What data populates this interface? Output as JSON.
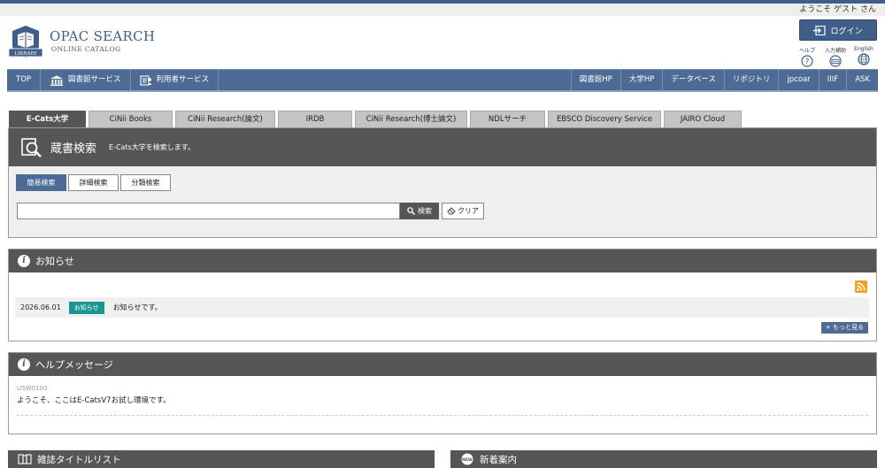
{
  "header": {
    "welcome": "ようこそ ゲスト さん",
    "logo_title": "OPAC SEARCH",
    "logo_subtitle": "ONLINE CATALOG",
    "logo_ribbon": "LIBRARY",
    "login_label": "ログイン",
    "utilities": [
      {
        "label": "ヘルプ",
        "icon": "help-icon"
      },
      {
        "label": "入力補助",
        "icon": "keyboard-icon"
      },
      {
        "label": "English",
        "icon": "globe-icon"
      }
    ]
  },
  "nav": {
    "left": [
      {
        "label": "TOP"
      },
      {
        "label": "図書館サービス",
        "icon": "library-icon"
      },
      {
        "label": "利用者サービス",
        "icon": "user-service-icon"
      }
    ],
    "right": [
      "図書館HP",
      "大学HP",
      "データベース",
      "リポジトリ",
      "jpcoar",
      "IIIF",
      "ASK"
    ]
  },
  "tabs": [
    "E-Cats大学",
    "CiNii Books",
    "CiNii Research(論文)",
    "IRDB",
    "CiNii Research(博士論文)",
    "NDLサーチ",
    "EBSCO Discovery Service",
    "JAIRO Cloud"
  ],
  "search": {
    "title": "蔵書検索",
    "description": "E-Cats大学を検索します。",
    "modes": [
      "簡易検索",
      "詳細検索",
      "分類検索"
    ],
    "input_value": "",
    "search_label": "検索",
    "clear_label": "クリア"
  },
  "news": {
    "title": "お知らせ",
    "items": [
      {
        "date": "2026.06.01",
        "badge": "お知らせ",
        "text": "お知らせです。"
      }
    ],
    "more_label": "+ もっと見る"
  },
  "help": {
    "title": "ヘルプメッセージ",
    "code": "USW0100",
    "text": "ようこそ、ここはE-CatsV7お試し環境です。"
  },
  "bottom": {
    "journal_title": "雑誌タイトルリスト",
    "new_arrivals_title": "新着案内"
  },
  "colors": {
    "brand": "#3f5f8a",
    "nav": "#4d6b94",
    "panel_header": "#565659",
    "badge": "#16968e",
    "rss": "#f5a020"
  }
}
